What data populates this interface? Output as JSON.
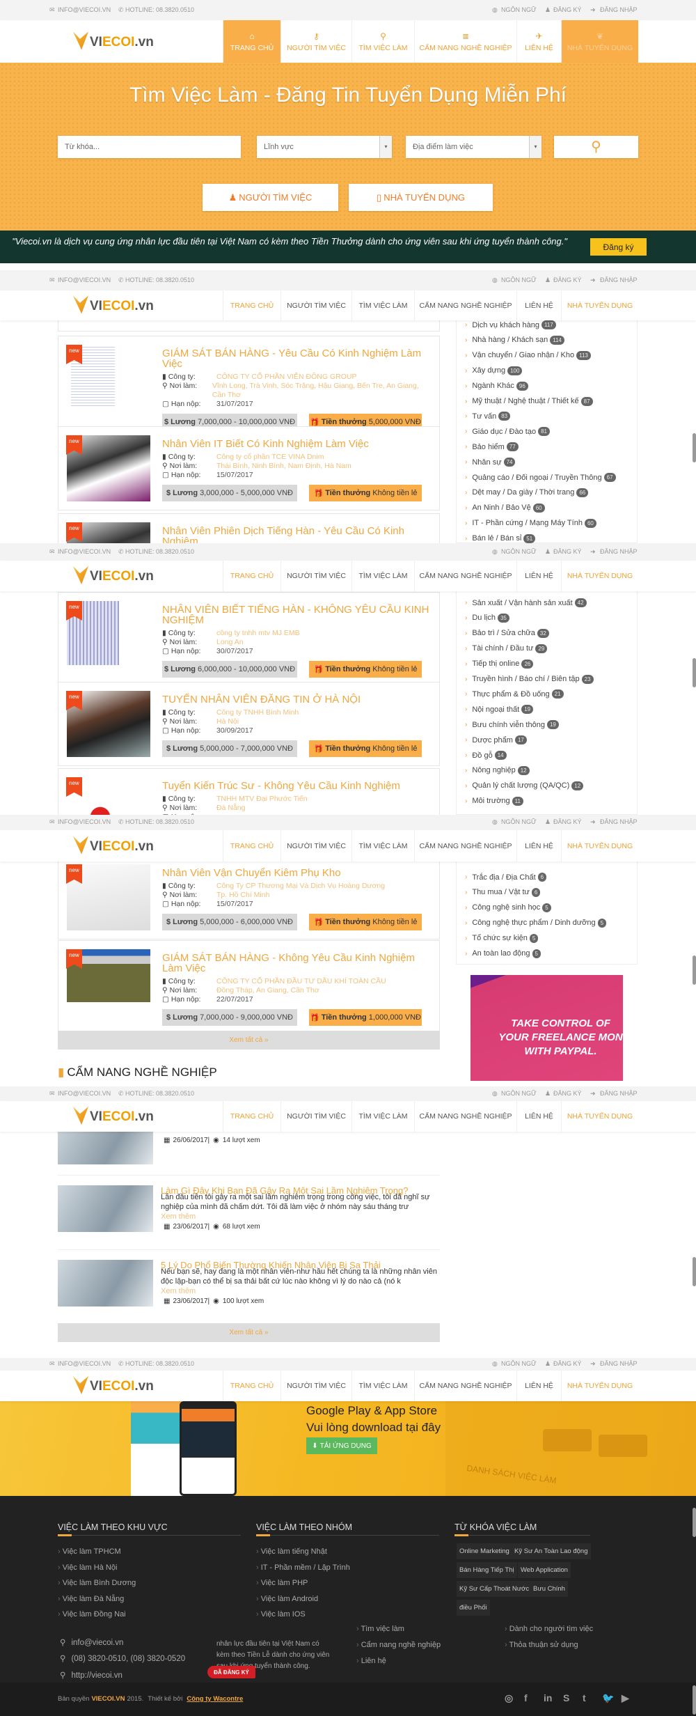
{
  "topbar": {
    "email": "INFO@VIECOI.VN",
    "hotline": "HOTLINE: 08.3820.0510",
    "language": "NGÔN NGỮ",
    "register": "ĐĂNG KÝ",
    "login": "ĐĂNG NHẬP"
  },
  "logo": {
    "prefix": "VI",
    "mid": "ECOI",
    "suffix": ".vn"
  },
  "nav": [
    {
      "label": "TRANG CHỦ",
      "icon": "home-icon"
    },
    {
      "label": "NGƯỜI TÌM VIỆC",
      "icon": "key-icon"
    },
    {
      "label": "TÌM VIỆC LÀM",
      "icon": "search-icon"
    },
    {
      "label": "CẨM NANG NGHỀ NGHIỆP",
      "icon": "list-icon"
    },
    {
      "label": "LIÊN HỆ",
      "icon": "paper-plane-icon"
    },
    {
      "label": "NHÀ TUYỂN DỤNG",
      "icon": "leaf-icon"
    }
  ],
  "hero": {
    "title": "Tìm Việc Làm - Đăng Tin Tuyển Dụng Miễn Phí",
    "keyword_placeholder": "Từ khóa...",
    "field_select": "Lĩnh vực",
    "location_select": "Địa điểm làm việc",
    "seeker_button": "NGƯỜI TÌM VIỆC",
    "employer_button": "NHÀ TUYỂN DỤNG"
  },
  "quote": {
    "text": "\"Viecoi.vn là dịch vụ cung ứng nhân lực đầu tiên tại Việt Nam có kèm theo Tiền Thưởng dành cho ứng viên sau khi ứng tuyển thành công.\"",
    "button": "Đăng ký"
  },
  "labels": {
    "company": "Công ty:",
    "location": "Nơi làm:",
    "deadline": "Hạn nộp:",
    "salary": "Lương",
    "bonus": "Tiền thưởng",
    "new": "new",
    "view_all": "Xem tất cả »",
    "read_more": "Xem thêm"
  },
  "jobs": [
    {
      "title": "GIÁM SÁT BÁN HÀNG - Yêu Cầu Có Kinh Nghiệm Làm Việc",
      "company": "CÔNG TY CỔ PHẦN VIỄN ĐÔNG GROUP",
      "location": "Vĩnh Long, Trà Vinh, Sóc Trăng, Hậu Giang, Bến Tre, An Giang, Cần Thơ",
      "deadline": "31/07/2017",
      "salary": "7,000,000 - 10,000,000 VNĐ",
      "bonus": "5,000,000 VNĐ"
    },
    {
      "title": "Nhân Viên IT Biết Có Kinh Nghiệm Làm Việc",
      "company": "Công ty cổ phần TCE VINA Dnim",
      "location": "Thái Bình, Ninh Bình, Nam Định, Hà Nam",
      "deadline": "15/07/2017",
      "salary": "3,000,000 - 5,000,000 VNĐ",
      "bonus": "Không tiền lẻ"
    },
    {
      "title": "Nhân Viên Phiên Dịch Tiếng Hàn - Yêu Cầu Có Kinh Nghiệm",
      "company": "",
      "location": "",
      "deadline": "",
      "salary": "",
      "bonus": ""
    },
    {
      "title": "NHÂN VIÊN BIẾT TIẾNG HÀN - KHÔNG YÊU CẦU KINH NGHIỆM",
      "company": "công ty tnhh mtv MJ EMB",
      "location": "Long An",
      "deadline": "30/07/2017",
      "salary": "6,000,000 - 10,000,000 VNĐ",
      "bonus": "Không tiền lẻ"
    },
    {
      "title": "TUYỂN NHÂN VIÊN ĐĂNG TIN Ở HÀ NỘI",
      "company": "Công ty TNHH Bình Minh",
      "location": "Hà Nội",
      "deadline": "30/09/2017",
      "salary": "5,000,000 - 7,000,000 VNĐ",
      "bonus": "Không tiền lẻ"
    },
    {
      "title": "Tuyển Kiến Trúc Sư - Không Yêu Cầu Kinh Nghiệm",
      "company": "TNHH MTV Đại Phước Tiến",
      "location": "Đà Nẵng",
      "deadline": "",
      "salary": "",
      "bonus": ""
    },
    {
      "title": "Nhân Viên Vận Chuyển Kiêm Phụ Kho",
      "company": "Công Ty CP Thương Mại Và Dịch Vụ Hoàng Dương",
      "location": "Tp. Hồ Chí Minh",
      "deadline": "15/07/2017",
      "salary": "5,000,000 - 6,000,000 VNĐ",
      "bonus": "Không tiền lẻ"
    },
    {
      "title": "GIÁM SÁT BÁN HÀNG - Không Yêu Cầu Kinh Nghiệm Làm Việc",
      "company": "CÔNG TY CỔ PHẦN ĐẦU TƯ DẦU KHÍ TOÀN CẦU",
      "location": "Đồng Tháp, An Giang, Cần Thơ",
      "deadline": "22/07/2017",
      "salary": "7,000,000 - 9,000,000 VNĐ",
      "bonus": "1,000,000 VNĐ"
    }
  ],
  "categories": [
    [
      {
        "name": "Dịch vụ khách hàng",
        "count": "117"
      },
      {
        "name": "Nhà hàng / Khách sạn",
        "count": "114"
      },
      {
        "name": "Vận chuyển / Giao nhận / Kho",
        "count": "113"
      },
      {
        "name": "Xây dựng",
        "count": "100"
      },
      {
        "name": "Ngành Khác",
        "count": "96"
      },
      {
        "name": "Mỹ thuật / Nghệ thuật / Thiết kế",
        "count": "87"
      },
      {
        "name": "Tư vấn",
        "count": "83"
      },
      {
        "name": "Giáo dục / Đào tạo",
        "count": "81"
      },
      {
        "name": "Bảo hiểm",
        "count": "77"
      },
      {
        "name": "Nhân sự",
        "count": "74"
      },
      {
        "name": "Quảng cáo / Đối ngoại / Truyền Thông",
        "count": "67"
      },
      {
        "name": "Dệt may / Da giày / Thời trang",
        "count": "66"
      },
      {
        "name": "An Ninh / Bảo Vệ",
        "count": "60"
      },
      {
        "name": "IT - Phần cứng / Mạng Máy Tính",
        "count": "60"
      },
      {
        "name": "Bán lẻ / Bán sỉ",
        "count": "51"
      }
    ],
    [
      {
        "name": "Sản xuất / Vận hành sản xuất",
        "count": "42"
      },
      {
        "name": "Du lịch",
        "count": "35"
      },
      {
        "name": "Bảo trì / Sửa chữa",
        "count": "32"
      },
      {
        "name": "Tài chính / Đầu tư",
        "count": "29"
      },
      {
        "name": "Tiếp thị online",
        "count": "26"
      },
      {
        "name": "Truyền hình / Báo chí / Biên tập",
        "count": "23"
      },
      {
        "name": "Thực phẩm & Đồ uống",
        "count": "21"
      },
      {
        "name": "Nội ngoại thất",
        "count": "19"
      },
      {
        "name": "Bưu chính viễn thông",
        "count": "19"
      },
      {
        "name": "Dược phẩm",
        "count": "17"
      },
      {
        "name": "Đồ gỗ",
        "count": "14"
      },
      {
        "name": "Nông nghiệp",
        "count": "12"
      },
      {
        "name": "Quản lý chất lượng (QA/QC)",
        "count": "12"
      },
      {
        "name": "Môi trường",
        "count": "11"
      }
    ],
    [
      {
        "name": "Trắc địa / Địa Chất",
        "count": "6"
      },
      {
        "name": "Thu mua / Vật tư",
        "count": "6"
      },
      {
        "name": "Công nghệ sinh học",
        "count": "5"
      },
      {
        "name": "Công nghệ thực phẩm / Dinh dưỡng",
        "count": "5"
      },
      {
        "name": "Tổ chức sự kiện",
        "count": "5"
      },
      {
        "name": "An toàn lao động",
        "count": "5"
      }
    ]
  ],
  "ad": {
    "text": "TAKE CONTROL OF YOUR FREELANCE MON WITH PAYPAL."
  },
  "career": {
    "heading": "CẨM NANG NGHỀ NGHIỆP",
    "articles": [
      {
        "title": "",
        "excerpt": "",
        "date": "26/06/2017|",
        "views": "14 lượt xem"
      },
      {
        "title": "Làm Gì Đây Khi Bạn Đã Gây Ra Một Sai Lầm Nghiêm Trọng?",
        "excerpt": "Lần đầu tiên tôi gây ra một sai lầm nghiêm trọng trong công việc, tôi đã nghĩ sự nghiệp của mình đã chấm dứt. Tôi đã làm việc ở nhóm này sáu tháng trư",
        "date": "23/06/2017|",
        "views": "68 lượt xem"
      },
      {
        "title": "5 Lý Do Phổ Biến Thường Khiến Nhân Viên Bị Sa Thải",
        "excerpt": "Nếu bạn sẽ, hay đang là một nhân viên-như hầu hết chúng ta là những nhân viên độc lập-bạn có thể bị sa thải bất cứ lúc nào không vì lý do nào cả (nó k",
        "date": "23/06/2017|",
        "views": "100 lượt xem"
      }
    ]
  },
  "app": {
    "line1": "Google Play & App Store",
    "line2": "Vui lòng download tại đây",
    "button": "TẢI ỨNG DỤNG",
    "mock_heading": "DANH SÁCH VIỆC LÀM"
  },
  "footer": {
    "col1": {
      "heading": "VIỆC LÀM THEO KHU VỰC",
      "links": [
        "Việc làm TPHCM",
        "Việc làm Hà Nội",
        "Việc làm Bình Dương",
        "Việc làm Đà Nẵng",
        "Việc làm Đồng Nai"
      ]
    },
    "col2": {
      "heading": "VIỆC LÀM THEO NHÓM",
      "links": [
        "Việc làm tiếng Nhật",
        "IT - Phần mềm / Lập Trình",
        "Việc làm PHP",
        "Việc làm Android",
        "Việc làm IOS"
      ]
    },
    "col3": {
      "heading": "TỪ KHÓA VIỆC LÀM",
      "tags": [
        "Online Marketing",
        "Kỹ Sư An Toàn Lao động",
        "Bán Hàng Tiếp Thị",
        "Web Application",
        "Kỹ Sư Cấp Thoát Nước",
        "Bưu Chính",
        "điều Phối"
      ]
    },
    "contact": {
      "email": "info@viecoi.vn",
      "phone": "(08) 3820-0510, (08) 3820-0520",
      "web": "http://viecoi.vn"
    },
    "about": "nhân lực đầu tiên tại Việt Nam có kèm theo Tiền Lễ dành cho ứng viên sau khi ứng tuyển thành công.",
    "links_a": [
      "Tìm việc làm",
      "Cẩm nang nghề nghiệp",
      "Liên hệ"
    ],
    "links_b": [
      "Dành cho người tìm việc",
      "Thỏa thuận sử dụng"
    ],
    "badge": "ĐÃ ĐĂNG KÝ",
    "copyright_prefix": "Bản quyền",
    "copyright_brand": "VIECOI.VN",
    "copyright_year": "2015.",
    "designed_by": "Thiết kế bởi",
    "designer": "Công ty Wacontre",
    "social": [
      "dribbble-icon",
      "facebook-icon",
      "linkedin-icon",
      "skype-icon",
      "tumblr-icon",
      "twitter-icon",
      "youtube-icon"
    ]
  },
  "colors": {
    "accent": "#f9ae4a",
    "accent_dark": "#f07d27",
    "title": "#f0a73e",
    "quote_bg": "#13362f",
    "register_btn": "#f7c21b",
    "footer_bg": "#222222",
    "app_button": "#5cb85c"
  }
}
